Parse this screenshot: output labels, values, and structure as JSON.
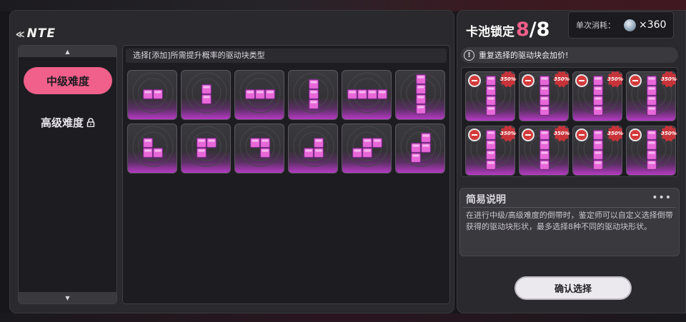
{
  "brand": "NTE",
  "sidebar": {
    "tabs": [
      {
        "label": "中级难度",
        "active": true,
        "locked": false
      },
      {
        "label": "高级难度",
        "active": false,
        "locked": true
      }
    ]
  },
  "content": {
    "header": "选择[添加]所需提升概率的驱动块类型",
    "pieces": [
      {
        "name": "h2"
      },
      {
        "name": "v2"
      },
      {
        "name": "h3"
      },
      {
        "name": "v3"
      },
      {
        "name": "h4"
      },
      {
        "name": "v4"
      },
      {
        "name": "L-small"
      },
      {
        "name": "J-small"
      },
      {
        "name": "L-small-2"
      },
      {
        "name": "J-big"
      },
      {
        "name": "S-horizontal"
      },
      {
        "name": "S-vertical"
      }
    ]
  },
  "right": {
    "lock_label": "卡池锁定",
    "lock_count": "8",
    "lock_total": "/8",
    "cost_label": "单次消耗：",
    "cost_value": "×360",
    "warning": "重复选择的驱动块会加价!",
    "slot_price": "350%",
    "slots": [
      {
        "piece": "v4"
      },
      {
        "piece": "v4"
      },
      {
        "piece": "v4"
      },
      {
        "piece": "v4"
      },
      {
        "piece": "v4"
      },
      {
        "piece": "v4"
      },
      {
        "piece": "v4"
      },
      {
        "piece": "v4"
      }
    ],
    "desc_title": "简易说明",
    "desc_more": "•••",
    "desc_text": "在进行中级/高级难度的倒带时，鉴定师可以自定义选择倒带获得的驱动块形状，最多选择8种不同的驱动块形状。",
    "confirm_label": "确认选择"
  },
  "colors": {
    "accent_pink": "#f0608a",
    "piece_pink": "#e868d8",
    "panel_bg": "#2a292d"
  }
}
